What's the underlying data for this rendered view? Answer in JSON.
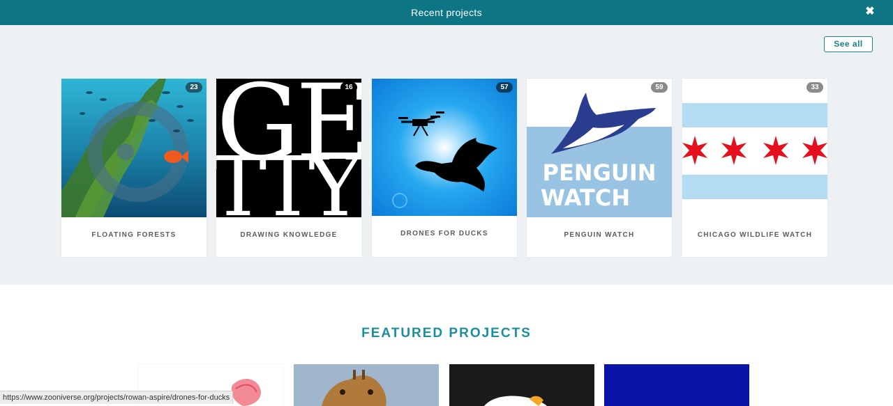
{
  "header": {
    "title": "Recent projects",
    "close_icon": "close-icon"
  },
  "recent": {
    "see_all_label": "See all",
    "projects": [
      {
        "name": "FLOATING FORESTS",
        "count": "23"
      },
      {
        "name": "DRAWING KNOWLEDGE",
        "count": "16"
      },
      {
        "name": "DRONES FOR DUCKS",
        "count": "57"
      },
      {
        "name": "PENGUIN WATCH",
        "count": "59"
      },
      {
        "name": "CHICAGO WILDLIFE WATCH",
        "count": "33"
      }
    ],
    "penguin_logo_text": [
      "PENGUIN",
      "WATCH"
    ],
    "drawing_logo_text": [
      "GE",
      "TTY"
    ]
  },
  "featured": {
    "title": "FEATURED PROJECTS",
    "projects": [
      "featured-project-1",
      "featured-project-2",
      "featured-project-3",
      "featured-project-4"
    ]
  },
  "status_bar": {
    "url": "https://www.zooniverse.org/projects/rowan-aspire/drones-for-ducks"
  },
  "colors": {
    "header_bg": "#0d7583",
    "accent": "#1a8f9c",
    "section_bg": "#eef1f4"
  }
}
